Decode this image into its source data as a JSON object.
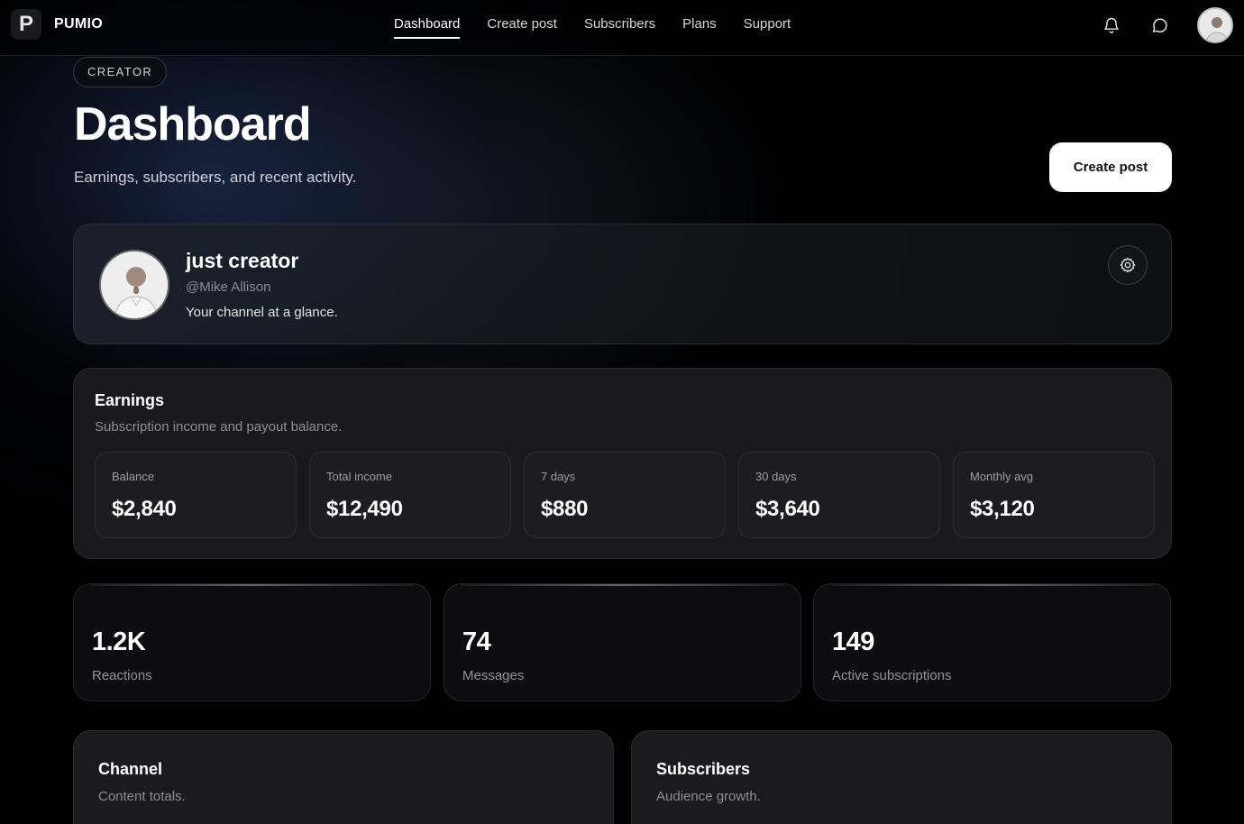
{
  "nav": {
    "logo_letter": "P",
    "brand": "PUMIO",
    "links": [
      {
        "label": "Dashboard",
        "active": true
      },
      {
        "label": "Create post",
        "active": false
      },
      {
        "label": "Subscribers",
        "active": false
      },
      {
        "label": "Plans",
        "active": false
      },
      {
        "label": "Support",
        "active": false
      }
    ],
    "icons": [
      "bell-icon",
      "chat-icon",
      "avatar"
    ]
  },
  "header": {
    "badge": "CREATOR",
    "title": "Dashboard",
    "subtitle": "Earnings, subscribers, and recent activity.",
    "create_button": "Create post"
  },
  "profile": {
    "name": "just creator",
    "handle": "@Mike Allison",
    "description": "Your channel at a glance.",
    "settings_icon": "gear-icon"
  },
  "earnings": {
    "title": "Earnings",
    "subtitle": "Subscription income and payout balance.",
    "stats": [
      {
        "label": "Balance",
        "value": "$2,840"
      },
      {
        "label": "Total income",
        "value": "$12,490"
      },
      {
        "label": "7 days",
        "value": "$880"
      },
      {
        "label": "30 days",
        "value": "$3,640"
      },
      {
        "label": "Monthly avg",
        "value": "$3,120"
      }
    ]
  },
  "metrics": [
    {
      "value": "1.2K",
      "label": "Reactions"
    },
    {
      "value": "74",
      "label": "Messages"
    },
    {
      "value": "149",
      "label": "Active subscriptions"
    }
  ],
  "channel": {
    "title": "Channel",
    "subtitle": "Content totals."
  },
  "subscribers": {
    "title": "Subscribers",
    "subtitle": "Audience growth."
  },
  "colors": {
    "background": "#000000",
    "card": "#1a1a1c",
    "accent_button": "#ffffff"
  }
}
